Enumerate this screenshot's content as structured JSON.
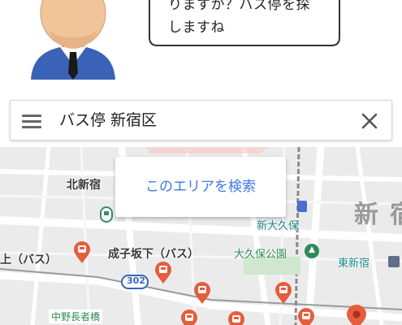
{
  "assistant": {
    "message_lines": [
      "りますか？バス停を探",
      "しますね"
    ]
  },
  "search": {
    "query": "バス停 新宿区"
  },
  "map": {
    "search_area_button": "このエリアを検索",
    "labels": {
      "kita_shinjuku": "北新宿",
      "shin_ookubo": "新大久保",
      "ookubo_park": "大久保公園",
      "higashi_shinjuku": "東新宿",
      "naruko_zaka": "成子坂下（バス）",
      "ue_bus": "上（バス）",
      "nakano_chojabashi": "中野長者橋",
      "big_shin": "新",
      "big_juku": "宿",
      "route_302": "302"
    },
    "colors": {
      "bus_pin": "#e45d3c",
      "selected_pin": "#e45d3c",
      "link_blue": "#3b78e7",
      "road_label_red": "#e06b5a"
    }
  }
}
